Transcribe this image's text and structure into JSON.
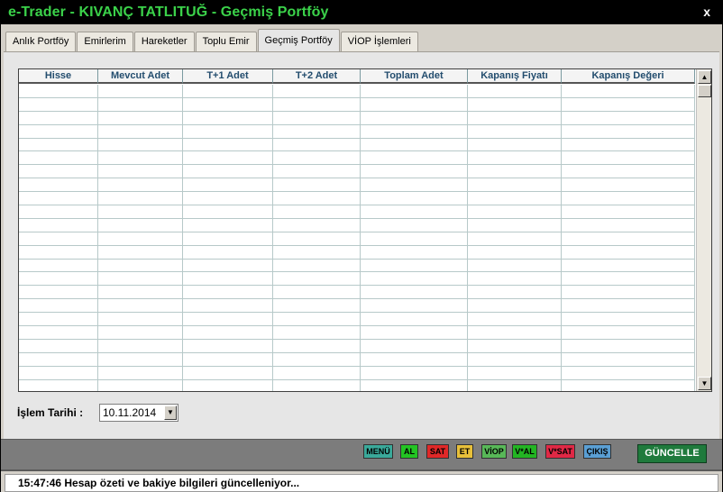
{
  "window": {
    "title": "e-Trader - KIVANÇ TATLITUĞ - Geçmiş Portföy",
    "close_label": "x"
  },
  "tabs": [
    {
      "label": "Anlık Portföy",
      "active": false
    },
    {
      "label": "Emirlerim",
      "active": false
    },
    {
      "label": "Hareketler",
      "active": false
    },
    {
      "label": "Toplu Emir",
      "active": false
    },
    {
      "label": "Geçmiş Portföy",
      "active": true
    },
    {
      "label": "VİOP İşlemleri",
      "active": false
    }
  ],
  "table": {
    "columns": [
      "Hisse",
      "Mevcut Adet",
      "T+1 Adet",
      "T+2 Adet",
      "Toplam Adet",
      "Kapanış Fiyatı",
      "Kapanış Değeri"
    ],
    "rows": []
  },
  "filter": {
    "date_label": "İşlem Tarihi :",
    "date_value": "10.11.2014"
  },
  "toolbar": {
    "buttons": [
      {
        "label": "MENÜ",
        "color": "#3aa99a"
      },
      {
        "label": "AL",
        "color": "#23c423"
      },
      {
        "label": "SAT",
        "color": "#e02828"
      },
      {
        "label": "ET",
        "color": "#e8c03a"
      },
      {
        "label": "VİOP",
        "color": "#58b858"
      },
      {
        "label": "V*AL",
        "color": "#23b523"
      },
      {
        "label": "V*SAT",
        "color": "#e02845"
      },
      {
        "label": "ÇIKIŞ",
        "color": "#5a9fd4"
      }
    ],
    "update_label": "GÜNCELLE"
  },
  "status": {
    "message": "15:47:46 Hesap özeti ve bakiye bilgileri güncelleniyor..."
  }
}
